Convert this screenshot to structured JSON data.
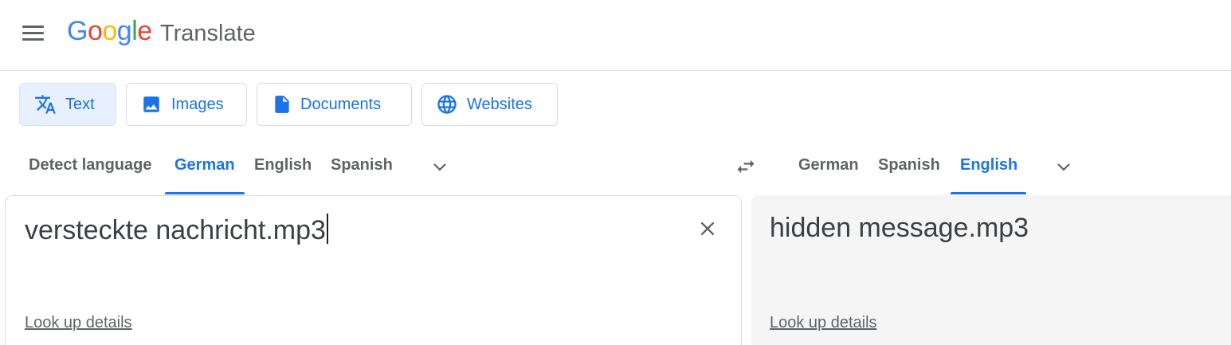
{
  "header": {
    "logo_letters": [
      "G",
      "o",
      "o",
      "g",
      "l",
      "e"
    ],
    "product": "Translate"
  },
  "modes": [
    {
      "label": "Text",
      "icon": "translate-icon",
      "active": true
    },
    {
      "label": "Images",
      "icon": "image-icon",
      "active": false
    },
    {
      "label": "Documents",
      "icon": "document-icon",
      "active": false
    },
    {
      "label": "Websites",
      "icon": "globe-icon",
      "active": false
    }
  ],
  "source_langs": [
    "Detect language",
    "German",
    "English",
    "Spanish"
  ],
  "source_active": "German",
  "target_langs": [
    "German",
    "Spanish",
    "English"
  ],
  "target_active": "English",
  "source": {
    "text": "versteckte nachricht.mp3",
    "lookup": "Look up details"
  },
  "target": {
    "text": "hidden message.mp3",
    "lookup": "Look up details"
  },
  "colors": {
    "accent": "#1a73e8",
    "active_tab_bg": "#e8f0fe",
    "target_panel_bg": "#f5f5f5"
  }
}
